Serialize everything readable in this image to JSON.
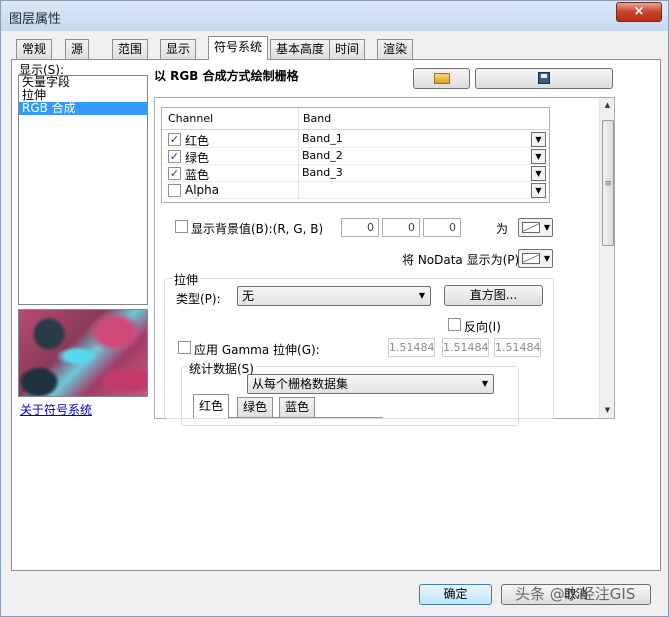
{
  "window": {
    "title": "图层属性",
    "close_glyph": "×"
  },
  "tabs": [
    {
      "label": "常规"
    },
    {
      "label": "源"
    },
    {
      "label": "范围"
    },
    {
      "label": "显示"
    },
    {
      "label": "符号系统"
    },
    {
      "label": "基本高度"
    },
    {
      "label": "时间"
    },
    {
      "label": "渲染"
    }
  ],
  "active_tab": "符号系统",
  "left": {
    "show_label": "显示(S):",
    "items": [
      {
        "label": "矢量字段"
      },
      {
        "label": "拉伸"
      },
      {
        "label": "RGB 合成"
      }
    ],
    "selected": "RGB 合成",
    "about_link": "关于符号系统"
  },
  "section_title": "以 RGB 合成方式绘制栅格",
  "icons": {
    "open": "folder-open-icon",
    "save": "save-icon"
  },
  "grid": {
    "headers": [
      "Channel",
      "Band"
    ],
    "rows": [
      {
        "channel": "红色",
        "band": "Band_1",
        "checked": "✓"
      },
      {
        "channel": "绿色",
        "band": "Band_2",
        "checked": "✓"
      },
      {
        "channel": "蓝色",
        "band": "Band_3",
        "checked": "✓"
      },
      {
        "channel": "Alpha",
        "band": "",
        "checked": ""
      }
    ]
  },
  "background": {
    "label": "显示背景值(B):(R, G, B)",
    "values": [
      "0",
      "0",
      "0"
    ],
    "as_label": "为"
  },
  "nodata": {
    "label": "将 NoData 显示为(P)"
  },
  "stretch": {
    "group_label": "拉伸",
    "type_label": "类型(P):",
    "type_value": "无",
    "histogram_button": "直方图...",
    "invert_label": "反向(I)",
    "gamma_label": "应用 Gamma 拉伸(G):",
    "gamma_values": [
      "1.51484",
      "1.51484",
      "1.51484"
    ]
  },
  "stats": {
    "group_label": "统计数据(S)",
    "source": "从每个栅格数据集",
    "subtabs": [
      {
        "label": "红色"
      },
      {
        "label": "绿色"
      },
      {
        "label": "蓝色"
      }
    ]
  },
  "footer": {
    "ok": "确定",
    "cancel": "取消"
  },
  "watermark": "头条 @水经注GIS"
}
